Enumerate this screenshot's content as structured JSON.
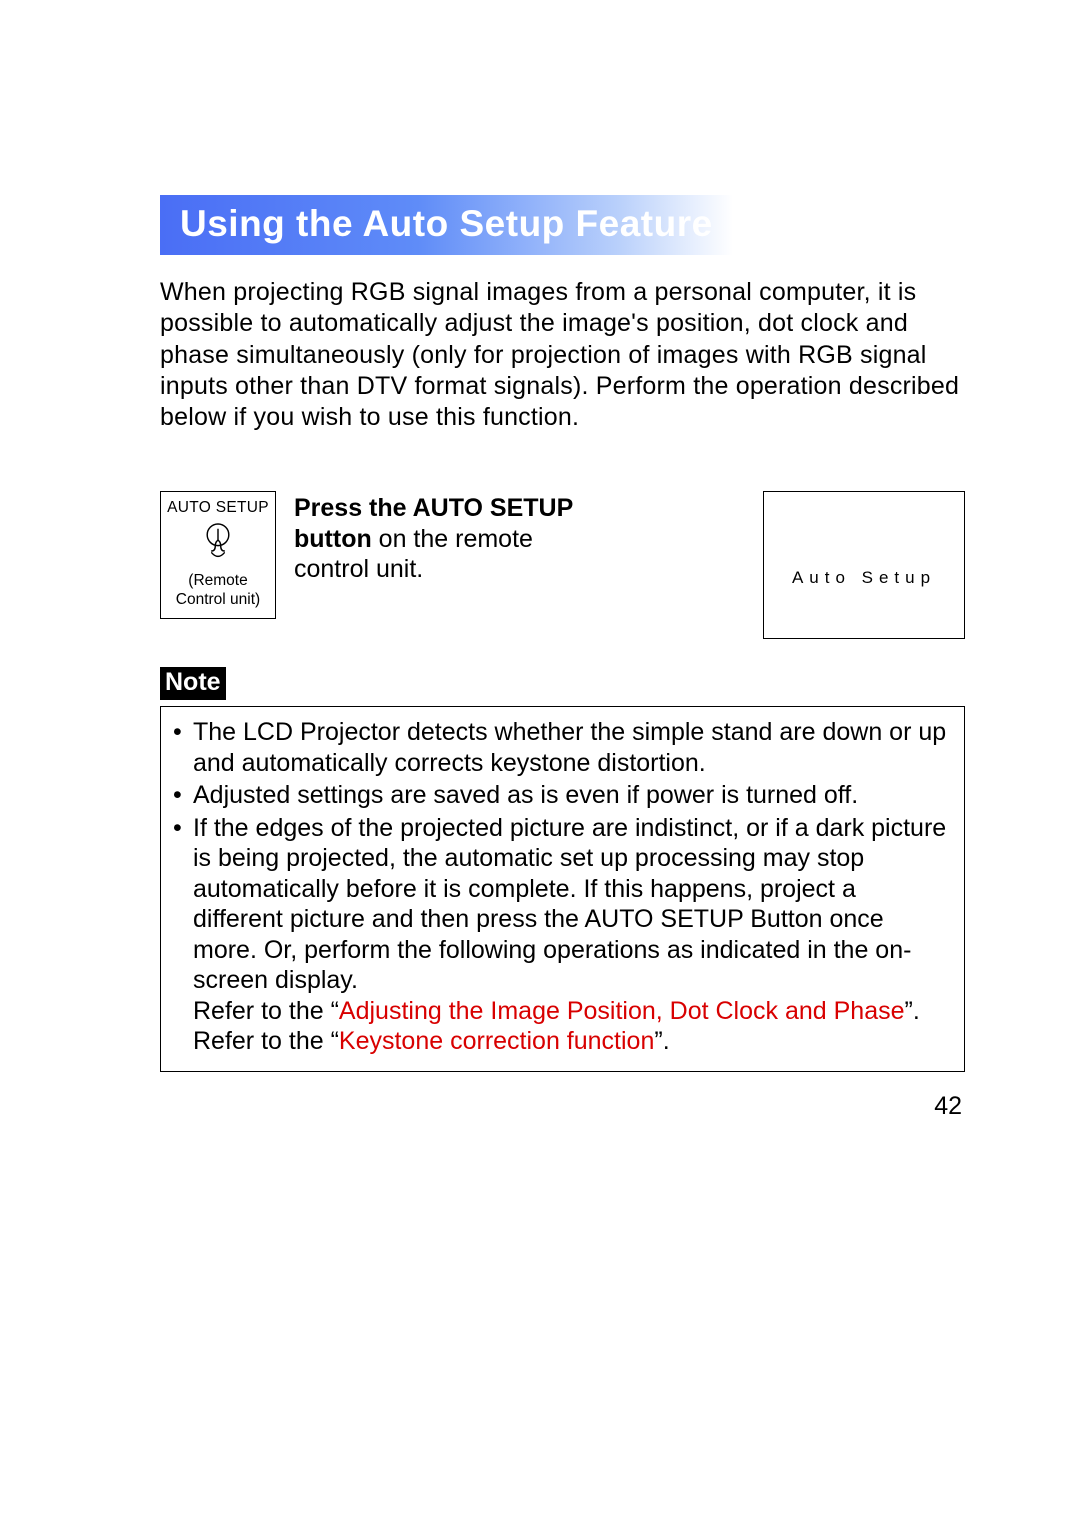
{
  "title": "Using the Auto Setup Feature",
  "intro": "When projecting RGB signal images from a personal computer, it is possible to automatically adjust the image's position, dot clock and phase simultaneously (only for projection of images with RGB signal inputs other than DTV format signals). Perform the operation described below if you wish to use this function.",
  "remote": {
    "top": "AUTO SETUP",
    "caption_line1": "(Remote",
    "caption_line2": "Control unit)"
  },
  "step": {
    "bold": "Press the AUTO SETUP button",
    "rest": " on the remote control unit."
  },
  "osd": {
    "text": "Auto Setup"
  },
  "note_label": "Note",
  "notes": {
    "b1": "The LCD Projector detects whether the simple stand are down or up and automatically corrects keystone distortion.",
    "b2": "Adjusted settings are saved as is even if power is turned off.",
    "b3_a": "If the edges of the projected picture are indistinct, or if a dark picture is being projected, the automatic set up processing may stop automatically before it is complete. If this happens, project a different picture and then press the AUTO SETUP Button once more. Or, perform the following operations as indicated in the on-screen display.",
    "b3_ref1_pre": "Refer to the “",
    "b3_ref1_link": "Adjusting the Image Position, Dot Clock and Phase",
    "b3_ref1_post": "”.",
    "b3_ref2_pre": "Refer to the “",
    "b3_ref2_link": "Keystone correction function",
    "b3_ref2_post": "”."
  },
  "page_number": "42"
}
